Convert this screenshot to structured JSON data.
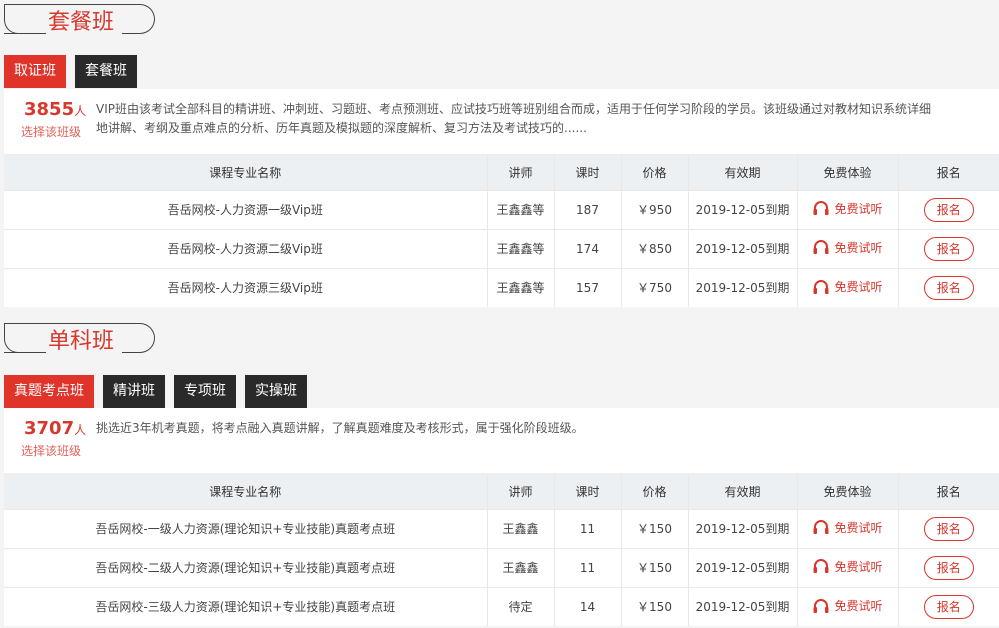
{
  "section1": {
    "title": "套餐班",
    "tabs": [
      {
        "label": "取证班"
      },
      {
        "label": "套餐班"
      }
    ],
    "count": "3855",
    "count_unit": "人",
    "choose_label": "选择该班级",
    "description": "VIP班由该考试全部科目的精讲班、冲刺班、习题班、考点预测班、应试技巧班等班别组合而成，适用于任何学习阶段的学员。该班级通过对教材知识系统详细地讲解、考纲及重点难点的分析、历年真题及模拟题的深度解析、复习方法及考试技巧的......",
    "headers": [
      "课程专业名称",
      "讲师",
      "课时",
      "价格",
      "有效期",
      "免费体验",
      "报名"
    ],
    "rows": [
      {
        "name": "吾岳网校-人力资源一级Vip班",
        "teacher": "王鑫鑫等",
        "hours": "187",
        "price": "￥950",
        "expiry": "2019-12-05到期",
        "trial": "免费试听",
        "signup": "报名"
      },
      {
        "name": "吾岳网校-人力资源二级Vip班",
        "teacher": "王鑫鑫等",
        "hours": "174",
        "price": "￥850",
        "expiry": "2019-12-05到期",
        "trial": "免费试听",
        "signup": "报名"
      },
      {
        "name": "吾岳网校-人力资源三级Vip班",
        "teacher": "王鑫鑫等",
        "hours": "157",
        "price": "￥750",
        "expiry": "2019-12-05到期",
        "trial": "免费试听",
        "signup": "报名"
      }
    ]
  },
  "section2": {
    "title": "单科班",
    "tabs": [
      {
        "label": "真题考点班"
      },
      {
        "label": "精讲班"
      },
      {
        "label": "专项班"
      },
      {
        "label": "实操班"
      }
    ],
    "count": "3707",
    "count_unit": "人",
    "choose_label": "选择该班级",
    "description": "挑选近3年机考真题，将考点融入真题讲解，了解真题难度及考核形式，属于强化阶段班级。",
    "headers": [
      "课程专业名称",
      "讲师",
      "课时",
      "价格",
      "有效期",
      "免费体验",
      "报名"
    ],
    "rows": [
      {
        "name": "吾岳网校-一级人力资源(理论知识+专业技能)真题考点班",
        "teacher": "王鑫鑫",
        "hours": "11",
        "price": "￥150",
        "expiry": "2019-12-05到期",
        "trial": "免费试听",
        "signup": "报名"
      },
      {
        "name": "吾岳网校-二级人力资源(理论知识+专业技能)真题考点班",
        "teacher": "王鑫鑫",
        "hours": "11",
        "price": "￥150",
        "expiry": "2019-12-05到期",
        "trial": "免费试听",
        "signup": "报名"
      },
      {
        "name": "吾岳网校-三级人力资源(理论知识+专业技能)真题考点班",
        "teacher": "待定",
        "hours": "14",
        "price": "￥150",
        "expiry": "2019-12-05到期",
        "trial": "免费试听",
        "signup": "报名"
      }
    ]
  },
  "colors": {
    "accent": "#d7372c",
    "tab_active": "#e0342b",
    "tab_inactive": "#2a2a2a",
    "header_bg": "#edf0f3"
  },
  "icons": {
    "trial": "headphones-icon"
  }
}
